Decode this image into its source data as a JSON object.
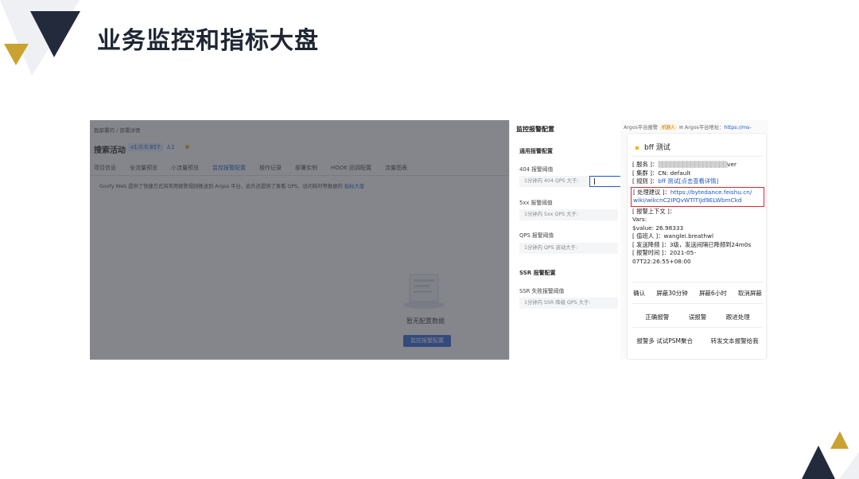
{
  "slide": {
    "title": "业务监控和指标大盘",
    "accent_dark": "#232a3b",
    "accent_gold": "#c9a230"
  },
  "left_app": {
    "breadcrumb": "我部署的 / 部署详情",
    "app_name": "搜索活动",
    "version": "v1.0.0.857",
    "member_count": "1",
    "tabs": [
      {
        "label": "项目信息",
        "active": false
      },
      {
        "label": "全流量预览",
        "active": false
      },
      {
        "label": "小流量预览",
        "active": false
      },
      {
        "label": "监控报警配置",
        "active": true
      },
      {
        "label": "操作记录",
        "active": false
      },
      {
        "label": "部署实例",
        "active": false
      },
      {
        "label": "HOOK 回调配置",
        "active": false
      },
      {
        "label": "流量图表",
        "active": false
      }
    ],
    "notice_text": "Goofy Web 提供了快捷方式将常用报警规则推送到 Argos 平台，此外还提供了查看 QPS、访问耗时等数据的",
    "notice_link": "指标大盘",
    "empty_text": "暂无配置数据",
    "empty_button": "监控报警配置"
  },
  "config_panel": {
    "title": "监控报警配置",
    "general_section": "通用报警配置",
    "items_general": [
      {
        "label": "404 报警阈值",
        "placeholder": "1分钟内 404 QPS 大于:"
      },
      {
        "label": "5xx 报警阈值",
        "placeholder": "1分钟内 5xx QPS 大于:"
      },
      {
        "label": "QPS 报警阈值",
        "placeholder": "1分钟内 QPS 波动大于:"
      }
    ],
    "ssr_section": "SSR 报警配置",
    "items_ssr": [
      {
        "label": "SSR 失败报警阈值",
        "placeholder": "1分钟内 SSR 降级 QPS 大于:"
      }
    ]
  },
  "alert_card": {
    "top_strip_prefix": "Argos平台报警",
    "bot_tag": "机器人",
    "top_strip_mid": "Argos平台地址：",
    "top_strip_url": "https://ms-",
    "title": "bff 测试",
    "service_prefix": "[ 服务 ]：",
    "service_suffix": "ver",
    "cluster": "[ 集群 ]：CN: default",
    "rule_prefix": "[ 规则 ]：",
    "rule_link": "bff 测试[点击查看详情]",
    "suggest_prefix": "[ 处理建议 ]：",
    "suggest_link_1": "https://bytedance.feishu.cn/",
    "suggest_link_2": "wiki/wikcnC2IPQvWTlTIJd9ELWbmCkd",
    "context": "[ 报警上下文 ]：",
    "vars": "Vars:",
    "value": "$value: 26.98333",
    "oncall": "[ 值班人 ]：wanglei.breathwl",
    "frequency": "[ 发送降频 ]：3级，发送间隔已降频到24m0s",
    "time_label": "[ 报警时间 ]：",
    "time_value_1": "2021-05-",
    "time_value_2": "07T22:26:55+08:00",
    "actions_row1": [
      "确认",
      "屏蔽30分钟",
      "屏蔽6小时",
      "取消屏蔽"
    ],
    "actions_row2": [
      "正确报警",
      "误报警",
      "跟进处理"
    ],
    "actions_row3": [
      "报警多 试试PSM聚合",
      "转发文本报警给我"
    ]
  }
}
